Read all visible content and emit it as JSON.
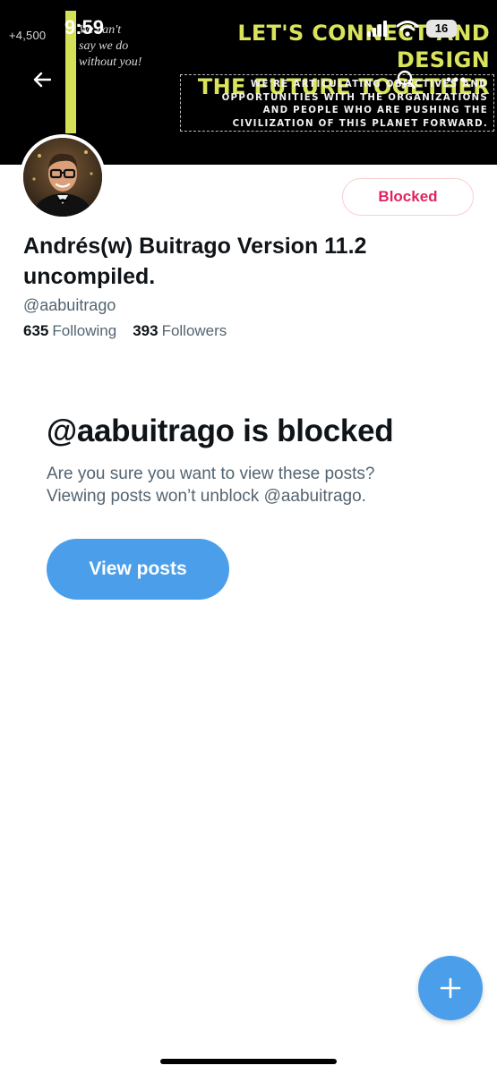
{
  "banner": {
    "count": "+4,500",
    "quote": "We can't\nsay we do\nwithout you!",
    "headline": "LET'S CONNECT AND DESIGN\nTHE FUTURE TOGETHER",
    "subtext": "WE'RE ARTICULATING OBJECTIVES AND\nOPPORTUNITIES WITH THE ORGANIZATIONS\nAND PEOPLE WHO ARE PUSHING THE\nCIVILIZATION OF THIS PLANET FORWARD."
  },
  "status_bar": {
    "time": "9:59",
    "battery": "16"
  },
  "nav": {
    "back_icon": "back-arrow-icon",
    "search_icon": "search-icon",
    "more_icon": "more-icon"
  },
  "profile": {
    "display_name": "Andrés(w) Buitrago Version 11.2 uncompiled.",
    "handle": "@aabuitrago",
    "following_count": "635",
    "following_label": "Following",
    "followers_count": "393",
    "followers_label": "Followers",
    "blocked_button": "Blocked"
  },
  "blocked_notice": {
    "title": "@aabuitrago is blocked",
    "message": "Are you sure you want to view these posts?\nViewing posts won’t unblock @aabuitrago.",
    "view_posts_button": "View posts"
  },
  "fab": {
    "icon": "plus-icon"
  },
  "colors": {
    "accent": "#4b9fea",
    "blocked_red": "#e0245e",
    "banner_yellow": "#d9e35b",
    "secondary_text": "#536471"
  }
}
